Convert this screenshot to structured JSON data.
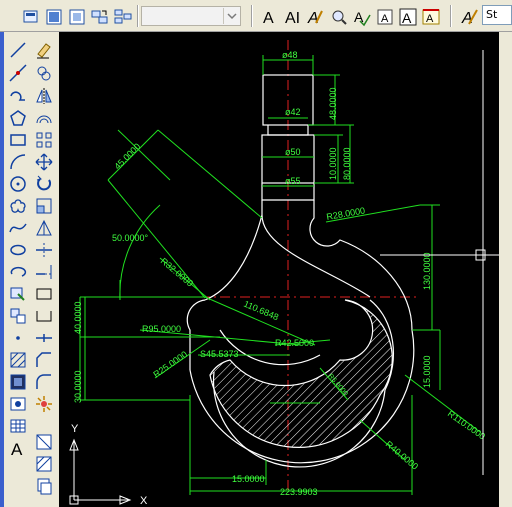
{
  "toolbar": {
    "layer_combo_value": "",
    "text_style_value": "St",
    "text_icons": [
      "A",
      "AI",
      "A",
      "A",
      "A"
    ]
  },
  "left_toolbar": {
    "text_tool_label": "A"
  },
  "drawing": {
    "ucs": {
      "x_label": "X",
      "y_label": "Y"
    },
    "dimensions": {
      "d48": "ø48",
      "d42": "ø42",
      "d50": "ø50",
      "d55": "ø55",
      "v48": "48.0000",
      "v10": "10.0000",
      "v80": "80.0000",
      "r28": "R28.0000",
      "v130": "130.0000",
      "r40": "R40.0000",
      "d15": "15.0000",
      "r110": "R110.0000",
      "r40b": "R40.0000",
      "d15b": "15.0000",
      "d223": "223.9903",
      "d40": "40.0000",
      "d30": "30.0000",
      "r95": "R95.0000",
      "r25": "R25.0000",
      "s45": "S45.5373",
      "r42": "R42.5000",
      "d10": "110.6848",
      "r32": "R32.0000",
      "a50": "50.0000°",
      "l45": "45.0000",
      "r5": "R5.0000"
    }
  }
}
